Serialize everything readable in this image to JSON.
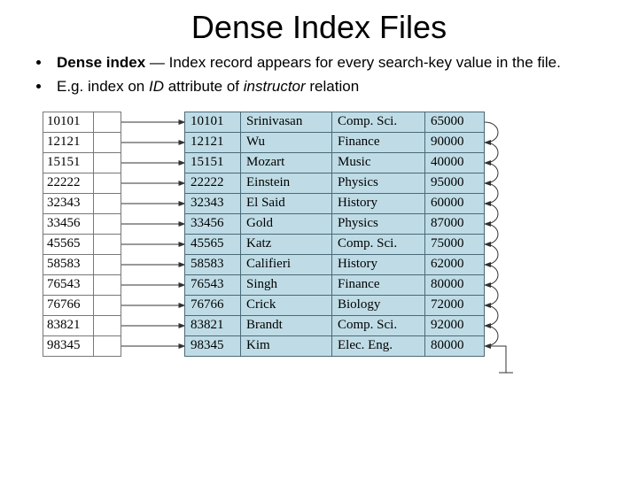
{
  "title": "Dense Index Files",
  "bullets": {
    "b1_lead": "Dense index",
    "b1_rest": " — Index record appears for every search-key value in the file.",
    "b2_pre": "E.g. index on ",
    "b2_id": "ID",
    "b2_mid": " attribute of ",
    "b2_rel": "instructor",
    "b2_post": " relation"
  },
  "index_keys": [
    "10101",
    "12121",
    "15151",
    "22222",
    "32343",
    "33456",
    "45565",
    "58583",
    "76543",
    "76766",
    "83821",
    "98345"
  ],
  "records": [
    {
      "id": "10101",
      "name": "Srinivasan",
      "dept": "Comp. Sci.",
      "salary": "65000"
    },
    {
      "id": "12121",
      "name": "Wu",
      "dept": "Finance",
      "salary": "90000"
    },
    {
      "id": "15151",
      "name": "Mozart",
      "dept": "Music",
      "salary": "40000"
    },
    {
      "id": "22222",
      "name": "Einstein",
      "dept": "Physics",
      "salary": "95000"
    },
    {
      "id": "32343",
      "name": "El Said",
      "dept": "History",
      "salary": "60000"
    },
    {
      "id": "33456",
      "name": "Gold",
      "dept": "Physics",
      "salary": "87000"
    },
    {
      "id": "45565",
      "name": "Katz",
      "dept": "Comp. Sci.",
      "salary": "75000"
    },
    {
      "id": "58583",
      "name": "Califieri",
      "dept": "History",
      "salary": "62000"
    },
    {
      "id": "76543",
      "name": "Singh",
      "dept": "Finance",
      "salary": "80000"
    },
    {
      "id": "76766",
      "name": "Crick",
      "dept": "Biology",
      "salary": "72000"
    },
    {
      "id": "83821",
      "name": "Brandt",
      "dept": "Comp. Sci.",
      "salary": "92000"
    },
    {
      "id": "98345",
      "name": "Kim",
      "dept": "Elec. Eng.",
      "salary": "80000"
    }
  ]
}
